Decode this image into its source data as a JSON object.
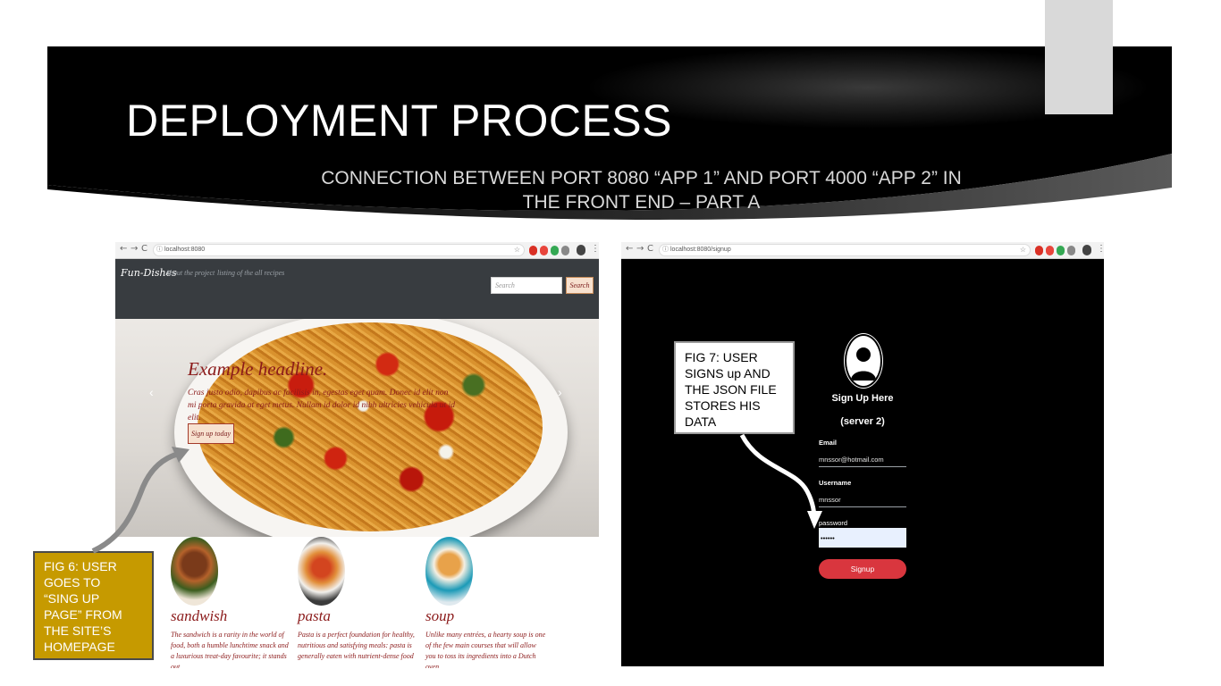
{
  "slide": {
    "title": "DEPLOYMENT PROCESS",
    "subtitle": "CONNECTION BETWEEN PORT 8080 “APP 1” AND PORT 4000 “APP 2” IN THE FRONT END – PART A"
  },
  "left_browser": {
    "url": "localhost:8080",
    "nav_back": "←",
    "nav_forward": "→",
    "nav_reload": "C",
    "brand": "Fun-Dishes",
    "nav_links": [
      "About the project",
      "listing of the all recipes"
    ],
    "search_placeholder": "Search",
    "search_button": "Search",
    "hero": {
      "headline": "Example headline.",
      "text": "Cras justo odio, dapibus ac facilisis in, egestas eget quam. Donec id elit non mi porta gravida at eget metus. Nullam id dolor id nibh ultricies vehicula ut id elit.",
      "cta": "Sign up today",
      "prev": "‹",
      "next": "›"
    },
    "cards": [
      {
        "title": "sandwish",
        "text": "The sandwich is a rarity in the world of food, both a humble lunchtime snack and a luxurious treat-day favourite; it stands out"
      },
      {
        "title": "pasta",
        "text": "Pasta is a perfect foundation for healthy, nutritious and satisfying meals: pasta is generally eaten with nutrient-dense food"
      },
      {
        "title": "soup",
        "text": "Unlike many entrées, a hearty soup is one of the few main courses that will allow you to toss its ingredients into a Dutch oven"
      }
    ]
  },
  "right_browser": {
    "url": "localhost:8080/signup",
    "heading": "Sign Up Here",
    "subheading": "(server 2)",
    "email_label": "Email",
    "email_value": "mnssor@hotmail.com",
    "username_label": "Username",
    "username_value": "mnssor",
    "password_label": "password",
    "password_value": "••••••",
    "signup_button": "Signup"
  },
  "callouts": {
    "fig6": "FIG 6: USER\nGOES TO\n“SING UP\nPAGE” FROM\nTHE  SITE’S\nHOMEPAGE",
    "fig7": "FIG 7: USER\nSIGNS up  AND\nTHE JSON FILE\nSTORES HIS\nDATA"
  },
  "colors": {
    "band": "#000000",
    "site_nav": "#383c40",
    "accent_red": "#8b1a1a",
    "fig6_fill": "#c69a00",
    "signup_button": "#d9363e"
  },
  "icons": [
    "back-arrow-icon",
    "forward-arrow-icon",
    "reload-icon",
    "info-icon",
    "star-icon",
    "avatar-icon",
    "curved-arrow-icon"
  ]
}
